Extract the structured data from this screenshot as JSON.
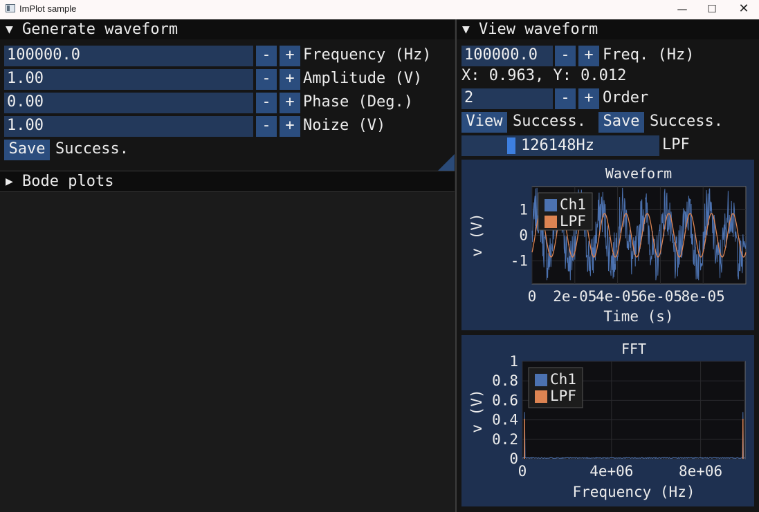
{
  "window": {
    "title": "ImPlot sample",
    "minimize_icon": "minimize-icon",
    "maximize_icon": "maximize-icon",
    "close_icon": "close-icon"
  },
  "generate": {
    "header": "Generate waveform",
    "fields": [
      {
        "value": "100000.0",
        "label": "Frequency (Hz)"
      },
      {
        "value": "1.00",
        "label": "Amplitude (V)"
      },
      {
        "value": "0.00",
        "label": "Phase (Deg.)"
      },
      {
        "value": "1.00",
        "label": "Noize (V)"
      }
    ],
    "minus": "-",
    "plus": "+",
    "save_label": "Save",
    "status": "Success."
  },
  "bode": {
    "header": "Bode plots"
  },
  "view": {
    "header": "View waveform",
    "freq_value": "100000.0",
    "freq_label": "Freq. (Hz)",
    "cursor_text": "X: 0.963, Y: 0.012",
    "order_value": "2",
    "order_label": "Order",
    "view_label": "View",
    "view_status": "Success.",
    "save_label": "Save",
    "save_status": "Success.",
    "slider_value": "126148Hz",
    "slider_fraction": 0.0,
    "slider_label": "LPF"
  },
  "colors": {
    "ch1": "#4c72b0",
    "lpf": "#dd8452",
    "field": "#23395b",
    "button": "#2b4d7e",
    "plot_frame": "#1e3050"
  },
  "chart_data": [
    {
      "type": "line",
      "title": "Waveform",
      "xlabel": "Time (s)",
      "ylabel": "v (V)",
      "x_ticks": [
        "0",
        "2e-05",
        "4e-05",
        "6e-05",
        "8e-05"
      ],
      "y_ticks": [
        "1",
        "0",
        "-1"
      ],
      "xlim": [
        0,
        0.0001
      ],
      "ylim": [
        -1.9,
        1.9
      ],
      "legend": {
        "position": "top-left",
        "entries": [
          "Ch1",
          "LPF"
        ]
      },
      "series": [
        {
          "name": "Ch1",
          "description": "sine 1.0 V + noise, 10 cycles over 0-0.0001 s"
        },
        {
          "name": "LPF",
          "frequency_hz": 100000,
          "amplitude": 0.85
        }
      ]
    },
    {
      "type": "line",
      "title": "FFT",
      "xlabel": "Frequency (Hz)",
      "ylabel": "v (V)",
      "x_ticks": [
        "0",
        "4e+06",
        "8e+06"
      ],
      "y_ticks": [
        "1",
        "0.8",
        "0.6",
        "0.4",
        "0.2",
        "0"
      ],
      "xlim": [
        0,
        10000000
      ],
      "ylim": [
        0,
        1
      ],
      "legend": {
        "position": "top-left",
        "entries": [
          "Ch1",
          "LPF"
        ]
      },
      "series": [
        {
          "name": "Ch1",
          "peaks": [
            {
              "x": 100000,
              "y": 0.48
            },
            {
              "x": 9900000,
              "y": 0.48
            }
          ],
          "noise_floor": 0.01
        },
        {
          "name": "LPF",
          "peaks": [
            {
              "x": 100000,
              "y": 0.41
            },
            {
              "x": 9900000,
              "y": 0.41
            }
          ]
        }
      ]
    }
  ]
}
